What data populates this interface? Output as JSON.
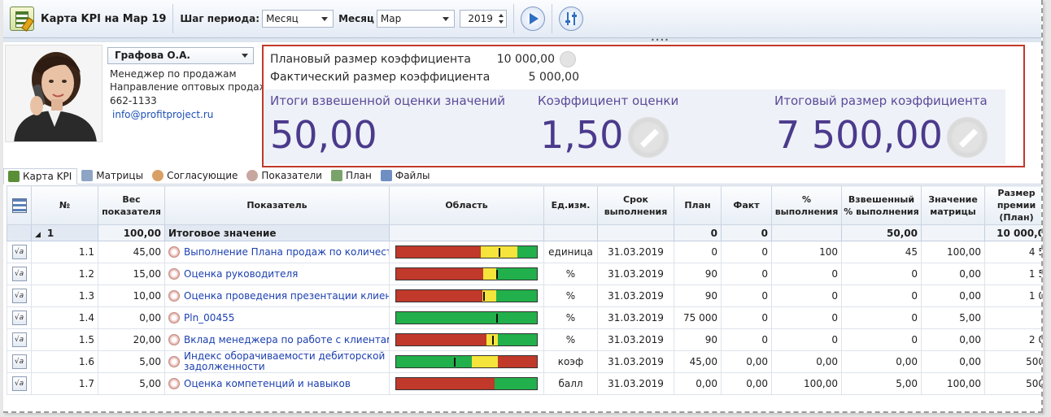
{
  "toolbar": {
    "title": "Карта KPI на Мар 19",
    "period_step_label": "Шаг периода:",
    "period_step_value": "Месяц",
    "month_label": "Месяц",
    "month_value": "Мар",
    "year_value": "2019"
  },
  "employee": {
    "name": "Графова О.А.",
    "position": "Менеджер по продажам",
    "department": "Направление оптовых продаж",
    "phone": "662-1133",
    "email": "info@profitproject.ru"
  },
  "kpi": {
    "planned_label": "Плановый размер коэффициента",
    "planned_value": "10 000,00",
    "actual_label": "Фактический размер коэффициента",
    "actual_value": "5 000,00",
    "weighted_label": "Итоги взвешенной оценки значений",
    "weighted_value": "50,00",
    "coef_label": "Коэффициент оценки",
    "coef_value": "1,50",
    "final_label": "Итоговый размер коэффициента",
    "final_value": "7 500,00"
  },
  "tabs": [
    {
      "label": "Карта KPI",
      "active": true
    },
    {
      "label": "Матрицы"
    },
    {
      "label": "Согласующие"
    },
    {
      "label": "Показатели"
    },
    {
      "label": "План"
    },
    {
      "label": "Файлы"
    }
  ],
  "columns": [
    "№",
    "Вес показателя",
    "Показатель",
    "Область",
    "Ед.изм.",
    "Срок выполнения",
    "План",
    "Факт",
    "% выполнения",
    "Взвешенный % выполнения",
    "Значение матрицы",
    "Размер премии (План)"
  ],
  "total_row": {
    "num": "1",
    "weight": "100,00",
    "name": "Итоговое значение",
    "plan": "0",
    "fact": "0",
    "weighted": "50,00",
    "bonus": "10 000,0"
  },
  "rows": [
    {
      "num": "1.1",
      "weight": "45,00",
      "name": "Выполнение Плана продаж по количеству",
      "unit": "единица",
      "deadline": "31.03.2019",
      "plan": "0",
      "fact": "0",
      "pct": "100",
      "weighted": "45",
      "matrix": "100,00",
      "bonus": "4 5",
      "bar": [
        {
          "c": "#c0392b",
          "w": 60
        },
        {
          "c": "#f5e43b",
          "w": 26
        },
        {
          "c": "#21b04b",
          "w": 14
        }
      ],
      "marker": 73
    },
    {
      "num": "1.2",
      "weight": "15,00",
      "name": "Оценка руководителя",
      "unit": "%",
      "deadline": "31.03.2019",
      "plan": "90",
      "fact": "0",
      "pct": "0",
      "weighted": "0",
      "matrix": "0,00",
      "bonus": "1 5",
      "bar": [
        {
          "c": "#c0392b",
          "w": 62
        },
        {
          "c": "#f5e43b",
          "w": 9
        },
        {
          "c": "#21b04b",
          "w": 29
        }
      ],
      "marker": 71
    },
    {
      "num": "1.3",
      "weight": "10,00",
      "name": "Оценка проведения презентации клиентам",
      "unit": "%",
      "deadline": "31.03.2019",
      "plan": "90",
      "fact": "0",
      "pct": "0",
      "weighted": "0",
      "matrix": "0,00",
      "bonus": "1 0",
      "bar": [
        {
          "c": "#c0392b",
          "w": 61
        },
        {
          "c": "#f5e43b",
          "w": 10
        },
        {
          "c": "#21b04b",
          "w": 29
        }
      ],
      "marker": 62
    },
    {
      "num": "1.4",
      "weight": "0,00",
      "name": "Pln_00455",
      "unit": "%",
      "deadline": "31.03.2019",
      "plan": "75 000",
      "fact": "0",
      "pct": "0",
      "weighted": "0",
      "matrix": "5,00",
      "bonus": "",
      "bar": [
        {
          "c": "#21b04b",
          "w": 100
        }
      ],
      "marker": 71
    },
    {
      "num": "1.5",
      "weight": "20,00",
      "name": "Вклад менеджера по работе с клиентами",
      "unit": "%",
      "deadline": "31.03.2019",
      "plan": "90",
      "fact": "0",
      "pct": "0",
      "weighted": "0",
      "matrix": "0,00",
      "bonus": "2 0",
      "bar": [
        {
          "c": "#c0392b",
          "w": 64
        },
        {
          "c": "#f5e43b",
          "w": 8
        },
        {
          "c": "#21b04b",
          "w": 28
        }
      ],
      "marker": 68
    },
    {
      "num": "1.6",
      "weight": "5,00",
      "name": "Индекс оборачиваемости дебиторской задолженности",
      "unit": "коэф",
      "deadline": "31.03.2019",
      "plan": "45,00",
      "fact": "0,00",
      "pct": "0,00",
      "weighted": "0,00",
      "matrix": "0,00",
      "bonus": "500",
      "bar": [
        {
          "c": "#21b04b",
          "w": 54
        },
        {
          "c": "#f5e43b",
          "w": 18
        },
        {
          "c": "#c0392b",
          "w": 28
        }
      ],
      "marker": 41
    },
    {
      "num": "1.7",
      "weight": "5,00",
      "name": "Оценка компетенций и навыков",
      "unit": "балл",
      "deadline": "31.03.2019",
      "plan": "0,00",
      "fact": "0,00",
      "pct": "100,00",
      "weighted": "5,00",
      "matrix": "100,00",
      "bonus": "500",
      "bar": [
        {
          "c": "#c0392b",
          "w": 70
        },
        {
          "c": "#21b04b",
          "w": 30
        }
      ],
      "marker": null
    }
  ]
}
